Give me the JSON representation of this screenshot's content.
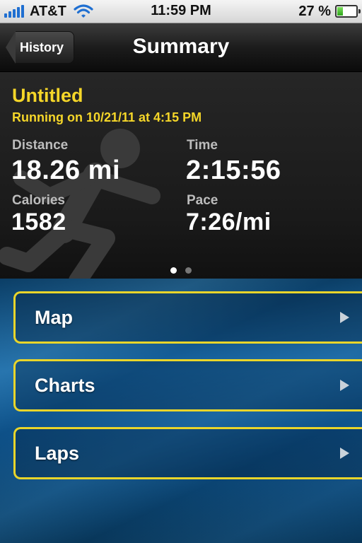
{
  "status_bar": {
    "carrier": "AT&T",
    "time": "11:59 PM",
    "battery_percent": "27 %",
    "battery_level": 0.27,
    "icons": [
      "signal-bars-icon",
      "wifi-icon",
      "battery-icon"
    ]
  },
  "nav": {
    "back_label": "History",
    "title": "Summary"
  },
  "summary": {
    "workout_title": "Untitled",
    "subtitle": "Running on 10/21/11 at 4:15 PM",
    "stats": {
      "distance_label": "Distance",
      "distance_value": "18.26 mi",
      "time_label": "Time",
      "time_value": "2:15:56",
      "calories_label": "Calories",
      "calories_value": "1582",
      "pace_label": "Pace",
      "pace_value": "7:26/mi"
    },
    "page_indicator": {
      "pages": 2,
      "current": 1
    }
  },
  "menu": {
    "items": [
      {
        "label": "Map"
      },
      {
        "label": "Charts"
      },
      {
        "label": "Laps"
      }
    ]
  },
  "colors": {
    "accent_yellow": "#f5d629",
    "menu_border": "#e9d52a",
    "menu_background": "#1663a0",
    "panel_background": "#1f1f1f"
  }
}
